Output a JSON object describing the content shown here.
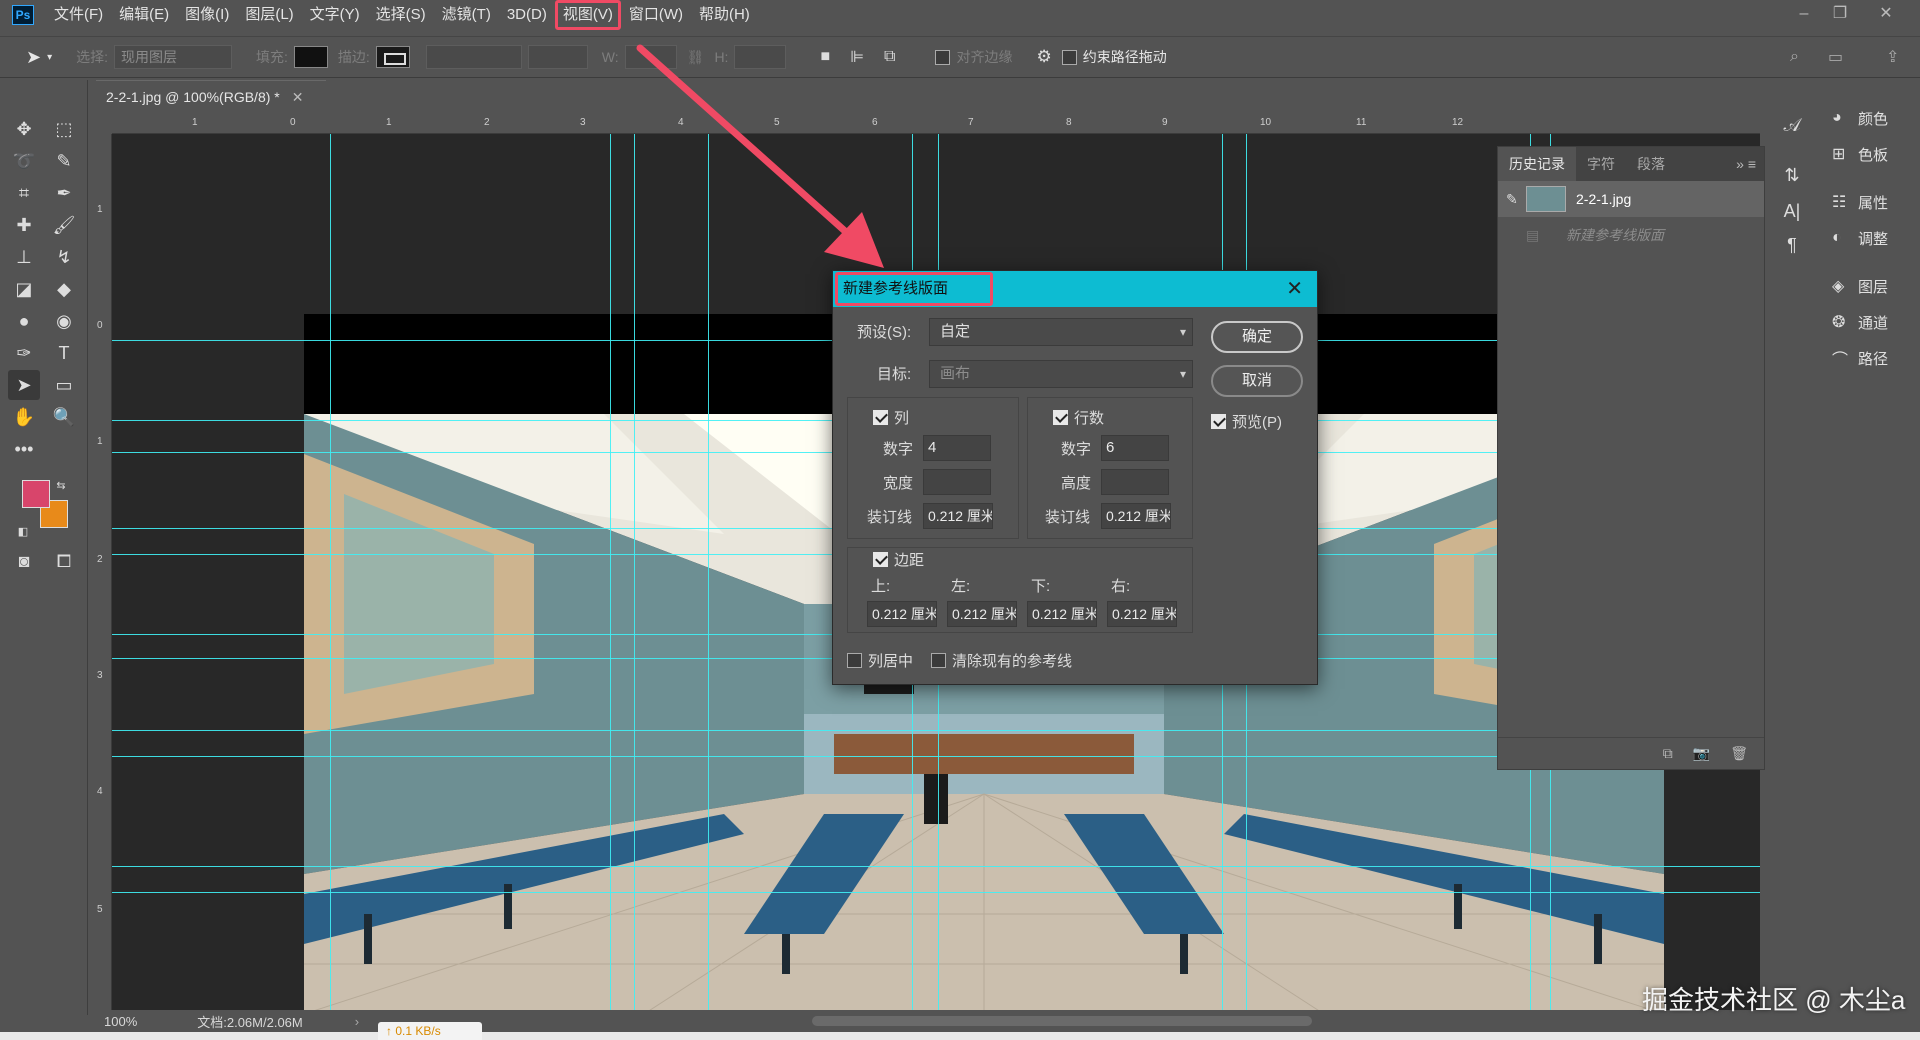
{
  "app": {
    "logo": "Ps"
  },
  "menu": [
    "文件(F)",
    "编辑(E)",
    "图像(I)",
    "图层(L)",
    "文字(Y)",
    "选择(S)",
    "滤镜(T)",
    "3D(D)",
    "视图(V)",
    "窗口(W)",
    "帮助(H)"
  ],
  "highlighted_menu": "视图(V)",
  "options": {
    "select_label": "选择:",
    "select_value": "现用图层",
    "fill_label": "填充:",
    "stroke_label": "描边:",
    "w_label": "W:",
    "h_label": "H:",
    "align_edges": "对齐边缘",
    "constrain_path": "约束路径拖动"
  },
  "document": {
    "tab_title": "2-2-1.jpg @ 100%(RGB/8) *",
    "zoom": "100%",
    "doc_size": "文档:2.06M/2.06M"
  },
  "rulers": {
    "h_ticks": [
      "1",
      "0",
      "1",
      "2",
      "3",
      "4",
      "5",
      "6",
      "7",
      "8",
      "9",
      "10",
      "11",
      "12"
    ],
    "v_ticks": [
      "1",
      "0",
      "1",
      "2",
      "3",
      "4",
      "5"
    ]
  },
  "history": {
    "tabs": [
      "历史记录",
      "字符",
      "段落"
    ],
    "snapshot": "2-2-1.jpg",
    "step": "新建参考线版面"
  },
  "dock": [
    "颜色",
    "色板",
    "属性",
    "调整",
    "图层",
    "通道",
    "路径"
  ],
  "dialog": {
    "title": "新建参考线版面",
    "preset_label": "预设(S):",
    "preset_value": "自定",
    "target_label": "目标:",
    "target_value": "画布",
    "ok": "确定",
    "cancel": "取消",
    "preview": "预览(P)",
    "columns": {
      "label": "列",
      "number_label": "数字",
      "number": "4",
      "width_label": "宽度",
      "width": "",
      "gutter_label": "装订线",
      "gutter": "0.212 厘米"
    },
    "rows": {
      "label": "行数",
      "number_label": "数字",
      "number": "6",
      "height_label": "高度",
      "height": "",
      "gutter_label": "装订线",
      "gutter": "0.212 厘米"
    },
    "margin": {
      "label": "边距",
      "top_label": "上:",
      "left_label": "左:",
      "bottom_label": "下:",
      "right_label": "右:",
      "top": "0.212 厘米",
      "left": "0.212 厘米",
      "bottom": "0.212 厘米",
      "right": "0.212 厘米"
    },
    "center_columns": "列居中",
    "clear_guides": "清除现有的参考线"
  },
  "status": {
    "net_speed": "↑ 0.1 KB/s"
  },
  "watermark": "掘金技术社区 @ 木尘a",
  "colors": {
    "foreground": "#d8456b",
    "background": "#e88a1a",
    "dialog_title": "#0dbcd2",
    "guides": "#3ff0f5",
    "highlight": "#f04a64"
  }
}
